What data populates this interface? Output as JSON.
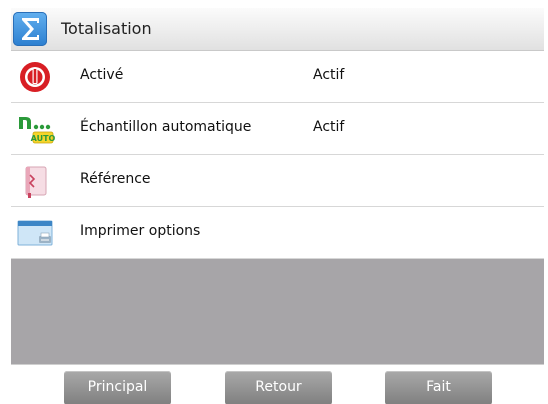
{
  "header": {
    "title": "Totalisation",
    "icon": "sigma-icon"
  },
  "menu": {
    "items": [
      {
        "label": "Activé",
        "value": "Actif",
        "icon": "power-icon"
      },
      {
        "label": "Échantillon automatique",
        "value": "Actif",
        "icon": "auto-sample-icon",
        "icon_text": "AUTO"
      },
      {
        "label": "Référence",
        "value": "",
        "icon": "reference-book-icon"
      },
      {
        "label": "Imprimer options",
        "value": "",
        "icon": "print-options-icon"
      }
    ]
  },
  "footer": {
    "principal_label": "Principal",
    "retour_label": "Retour",
    "fait_label": "Fait"
  },
  "colors": {
    "accent": "#2c7fd0",
    "power_red": "#d81e24",
    "auto_green": "#2b9a3a",
    "auto_yellow": "#f5d52a",
    "background_gray": "#a7a5a8",
    "button_gray": "#8e8e8e"
  }
}
